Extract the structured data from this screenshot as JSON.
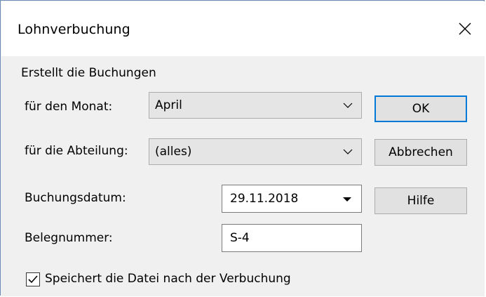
{
  "window": {
    "title": "Lohnverbuchung",
    "close_icon": "close-icon"
  },
  "group": {
    "caption": "Erstellt die Buchungen"
  },
  "month": {
    "label": "für den Monat:",
    "selected": "April"
  },
  "department": {
    "label": "für die Abteilung:",
    "selected": "(alles)"
  },
  "booking_date": {
    "label": "Buchungsdatum:",
    "value": "29.11.2018"
  },
  "voucher_number": {
    "label": "Belegnummer:",
    "value": "S-4"
  },
  "save_option": {
    "label": "Speichert die Datei nach der Verbuchung",
    "checked": true
  },
  "buttons": {
    "ok": "OK",
    "cancel": "Abbrechen",
    "help": "Hilfe"
  },
  "colors": {
    "default_button_border": "#0078d7",
    "dialog_background": "#f0f0f0"
  }
}
